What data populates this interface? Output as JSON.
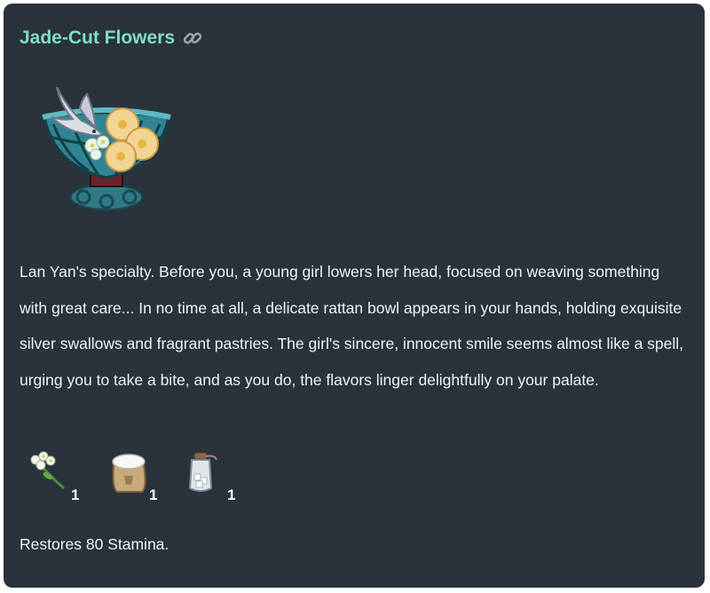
{
  "recipe": {
    "title": "Jade-Cut Flowers",
    "title_color": "#7ee0c3",
    "link_icon": "link-icon",
    "dish_icon": "rattan-bowl-swallows-pastries-icon",
    "description": "Lan Yan's specialty. Before you, a young girl lowers her head, focused on weaving something with great care... In no time at all, a delicate rattan bowl appears in your hands, holding exquisite silver swallows and fragrant pastries. The girl's sincere, innocent smile seems almost like a spell, urging you to take a bite, and as you do, the flavors linger delightfully on your palate.",
    "ingredients": [
      {
        "icon": "jasmine-flower-icon",
        "qty": "1"
      },
      {
        "icon": "flour-sack-icon",
        "qty": "1"
      },
      {
        "icon": "sugar-jar-icon",
        "qty": "1"
      }
    ],
    "effect": "Restores 80 Stamina."
  },
  "colors": {
    "background": "#29333b",
    "text": "#f1f1f1"
  }
}
